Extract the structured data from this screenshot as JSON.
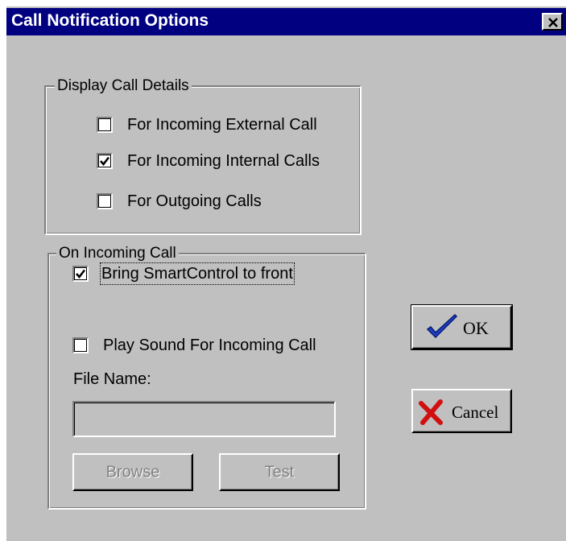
{
  "window": {
    "title": "Call Notification Options"
  },
  "display_group": {
    "label": "Display Call Details",
    "options": [
      {
        "label": "For Incoming External Call",
        "checked": false
      },
      {
        "label": "For Incoming Internal Calls",
        "checked": true
      },
      {
        "label": "For Outgoing Calls",
        "checked": false
      }
    ]
  },
  "incoming_group": {
    "label": "On Incoming Call",
    "bring_front": {
      "label": "Bring SmartControl to front",
      "checked": true
    },
    "play_sound": {
      "label": "Play Sound For Incoming Call",
      "checked": false
    },
    "file_name_label": "File Name:",
    "file_name_value": "",
    "browse_label": "Browse",
    "test_label": "Test"
  },
  "buttons": {
    "ok_label": "OK",
    "cancel_label": "Cancel"
  },
  "colors": {
    "titlebar": "#000080",
    "face": "#c0c0c0",
    "ok_check": "#1e40c8",
    "cancel_x": "#d01010"
  }
}
